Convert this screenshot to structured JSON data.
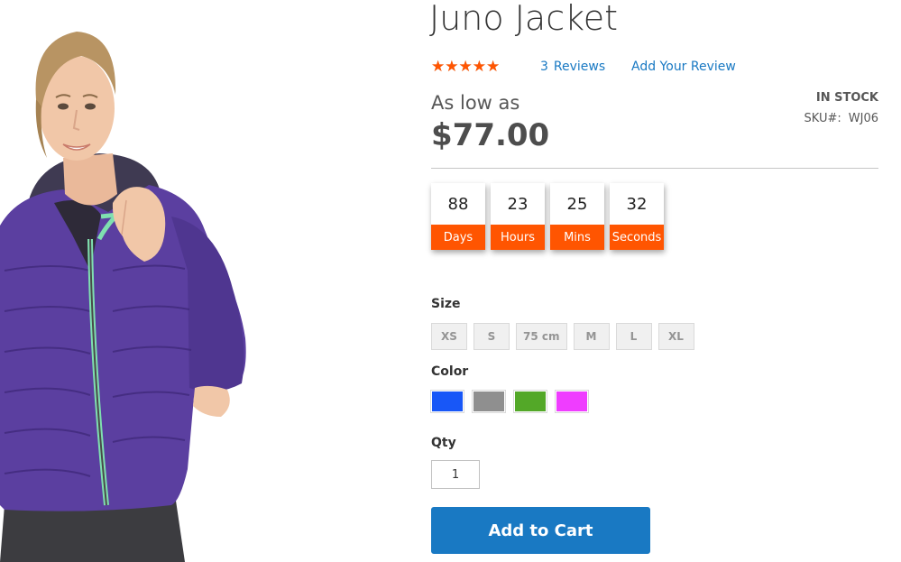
{
  "product": {
    "title": "Juno Jacket",
    "rating_percent": 85,
    "stars_glyphs": "★★★★★",
    "review_count": "3",
    "reviews_label": "Reviews",
    "add_review_label": "Add Your Review",
    "price_label": "As low as",
    "price": "$77.00",
    "stock_status": "IN STOCK",
    "sku_label": "SKU#:",
    "sku_value": "WJ06",
    "image_alt": "Juno Jacket"
  },
  "countdown": [
    {
      "value": "88",
      "unit": "Days"
    },
    {
      "value": "23",
      "unit": "Hours"
    },
    {
      "value": "25",
      "unit": "Mins"
    },
    {
      "value": "32",
      "unit": "Seconds"
    }
  ],
  "options": {
    "size_label": "Size",
    "sizes": [
      "XS",
      "S",
      "75 cm",
      "M",
      "L",
      "XL"
    ],
    "color_label": "Color",
    "colors": [
      {
        "name": "Blue",
        "hex": "#1857f7"
      },
      {
        "name": "Gray",
        "hex": "#8f8f8f"
      },
      {
        "name": "Green",
        "hex": "#53a828"
      },
      {
        "name": "Purple",
        "hex": "#ef3dff"
      }
    ],
    "qty_label": "Qty",
    "qty_value": "1"
  },
  "actions": {
    "add_to_cart": "Add to Cart"
  },
  "theme": {
    "accent": "#ff5501",
    "link": "#1979c3",
    "button": "#1979c3",
    "jacket": "#5b3fa0",
    "zipper_trim": "#7fe0b0"
  }
}
